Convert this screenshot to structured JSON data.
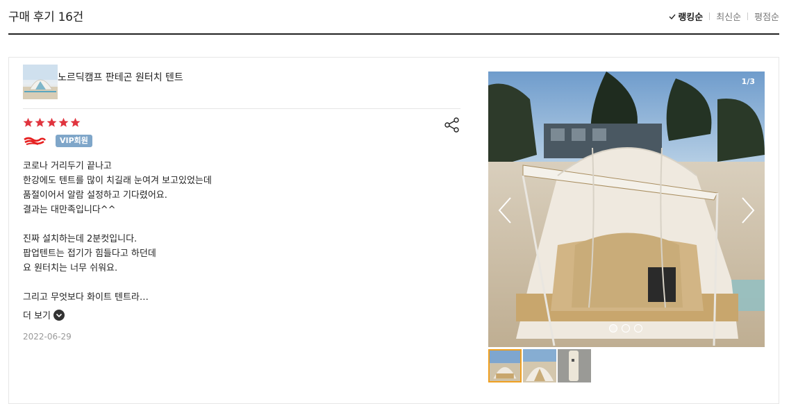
{
  "header": {
    "title": "구매 후기 16건",
    "sort": [
      {
        "label": "랭킹순",
        "active": true
      },
      {
        "label": "최신순",
        "active": false
      },
      {
        "label": "평점순",
        "active": false
      }
    ]
  },
  "review": {
    "product_name": "노르딕캠프 판테곤 원터치 텐트",
    "rating": 5,
    "star_color": "#e0343e",
    "badge": "VIP회원",
    "body_lines": [
      "코로나 거리두기 끝나고",
      "한강에도 텐트를 많이 치길래 눈여겨 보고있었는데",
      "품절이어서 알람 설정하고 기다렸어요.",
      "결과는 대만족입니다^^",
      "",
      "진짜 설치하는데 2분컷입니다.",
      "팝업텐트는 접기가 힘들다고 하던데",
      "요 원터치는 너무 쉬워요.",
      "",
      "그리고 무엇보다 화이트 텐트라…"
    ],
    "more_label": "더 보기",
    "date": "2022-06-29",
    "icons": {
      "share": "share-icon",
      "more": "chevron-down-icon"
    }
  },
  "gallery": {
    "counter": "1/3",
    "current_index": 1,
    "total": 3,
    "thumbnails": [
      "tent-photo-1",
      "tent-photo-2",
      "tent-photo-3"
    ]
  }
}
